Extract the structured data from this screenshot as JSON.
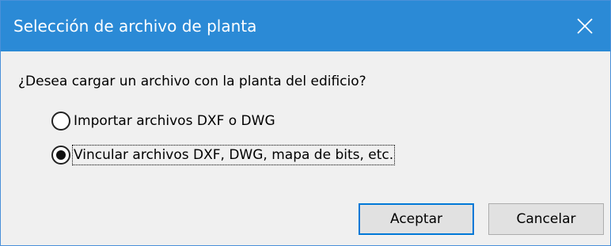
{
  "window": {
    "title": "Selección de archivo de planta",
    "close_icon": "close-icon"
  },
  "dialog": {
    "question": "¿Desea cargar un archivo con la planta del edificio?",
    "options": [
      {
        "label": "Importar archivos DXF o DWG",
        "selected": false
      },
      {
        "label": "Vincular archivos DXF, DWG, mapa de bits, etc.",
        "selected": true
      }
    ]
  },
  "buttons": {
    "accept_label": "Aceptar",
    "cancel_label": "Cancelar"
  },
  "colors": {
    "titlebar": "#2b8ad6",
    "default_button_border": "#0078d7"
  }
}
